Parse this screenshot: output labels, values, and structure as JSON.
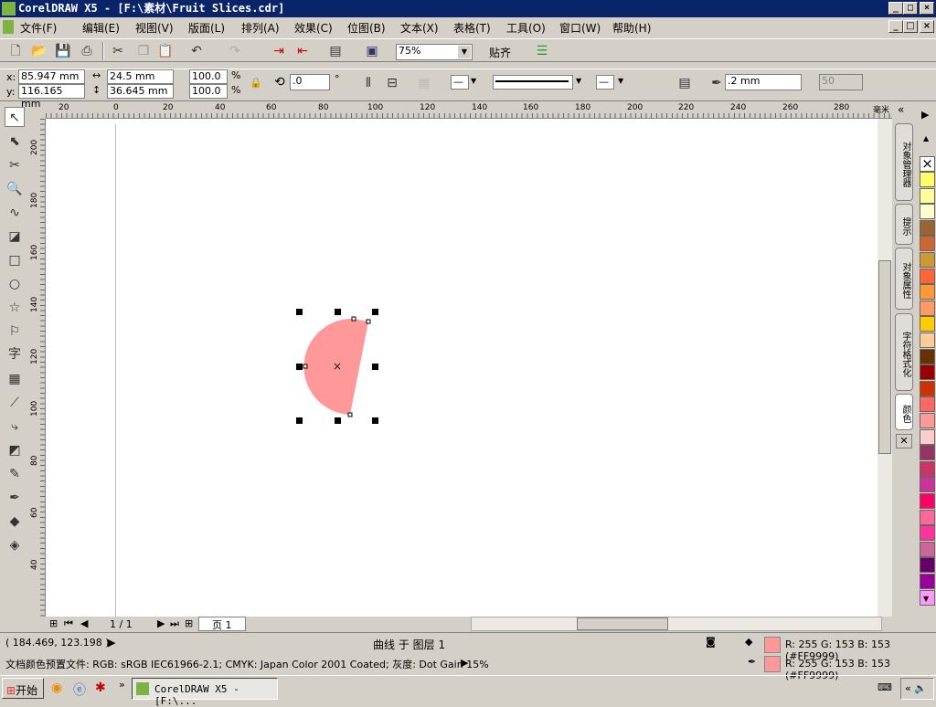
{
  "title": "CorelDRAW X5 - [F:\\素材\\Fruit Slices.cdr]",
  "menus": [
    "文件(F)",
    "编辑(E)",
    "视图(V)",
    "版面(L)",
    "排列(A)",
    "效果(C)",
    "位图(B)",
    "文本(X)",
    "表格(T)",
    "工具(O)",
    "窗口(W)",
    "帮助(H)"
  ],
  "toolbar": {
    "zoom": "75%",
    "snap": "贴齐"
  },
  "props": {
    "x": "85.947 mm",
    "y": "116.165 mm",
    "w": "24.5 mm",
    "h": "36.645 mm",
    "sx": "100.0",
    "sy": "100.0",
    "pct": "%",
    "angle": ".0",
    "deg": "°",
    "outline": ".2 mm",
    "nib": "50",
    "xl": "x:",
    "yl": "y:"
  },
  "ruler": {
    "h": [
      "20",
      "0",
      "20",
      "40",
      "60",
      "80",
      "100",
      "120",
      "140",
      "160",
      "180",
      "200",
      "220",
      "240",
      "260",
      "280"
    ],
    "unit": "毫米",
    "v": [
      "200",
      "180",
      "160",
      "140",
      "120",
      "100",
      "80",
      "60",
      "40"
    ]
  },
  "pages": {
    "count": "1 / 1",
    "tab": "页 1"
  },
  "status": {
    "coords": "( 184.469, 123.198 )",
    "object": "曲线 于 图层 1",
    "fill": "R: 255 G: 153 B: 153 (#FF9999)",
    "outline": "R: 255 G: 153 B: 153 (#FF9999)",
    "profile": "文档颜色预置文件: RGB: sRGB IEC61966-2.1; CMYK: Japan Color 2001 Coated; 灰度: Dot Gain 15%"
  },
  "dockers": [
    "对象管理器",
    "提示",
    "对象属性",
    "字符格式化",
    "颜色"
  ],
  "palette": [
    "#ffff66",
    "#ffff99",
    "#ffffcc",
    "#996633",
    "#cc6633",
    "#cc9933",
    "#ff6633",
    "#ff9933",
    "#ff9966",
    "#ffcc00",
    "#ffcc99",
    "#663300",
    "#990000",
    "#cc3300",
    "#ff6666",
    "#ff9999",
    "#ffcccc",
    "#993366",
    "#cc3366",
    "#cc3399",
    "#ff0066",
    "#ff6699",
    "#ff3399",
    "#cc6699",
    "#660066",
    "#990099",
    "#ff99ff"
  ],
  "shape_fill": "#FF9999",
  "taskbar": {
    "start": "开始",
    "task": "CorelDRAW X5 - [F:\\..."
  }
}
